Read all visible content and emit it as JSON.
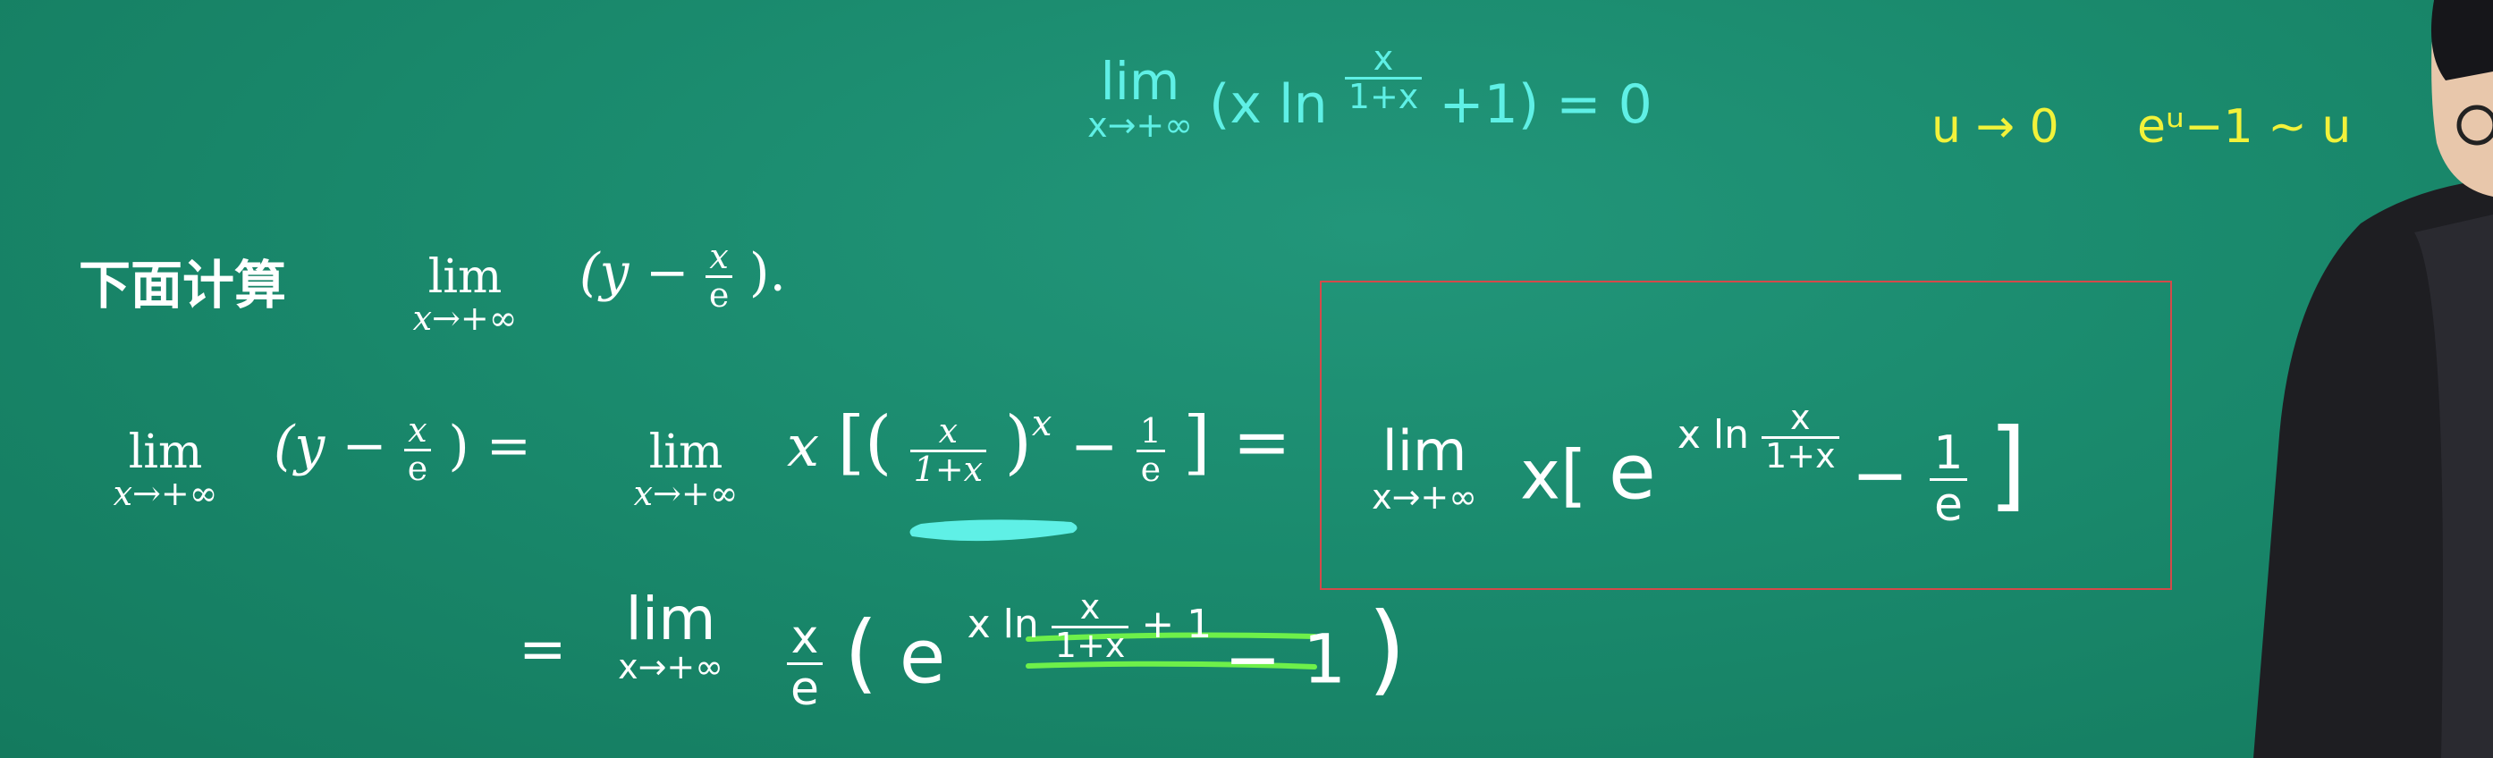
{
  "board": {
    "top_note": {
      "lim": "lim",
      "sub": "x→+∞",
      "expr_open": "(x ln",
      "frac_num": "x",
      "frac_den": "1+x",
      "expr_close": "+1) = 0"
    },
    "yellow_note": {
      "limit": "u → 0",
      "equiv": "eᵘ−1 ~ u"
    },
    "heading": {
      "label": "下面计算",
      "lim": "lim",
      "sub": "x→+∞",
      "expr_a": "(y −",
      "frac_num": "x",
      "frac_den": "e",
      "expr_b": ")."
    },
    "line1": {
      "lim1": "lim",
      "sub1": "x→+∞",
      "expr1": "(y −",
      "frac1_num": "x",
      "frac1_den": "e",
      "expr1_close": ") =",
      "lim2": "lim",
      "sub2": "x→+∞",
      "x_factor": "x",
      "bracket_open": "[(",
      "frac2_num": "x",
      "frac2_den": "1+x",
      "paren_close": ")",
      "power": "x",
      "minus": "−",
      "frac3_num": "1",
      "frac3_den": "e",
      "bracket_close": "] ="
    },
    "boxed": {
      "lim": "lim",
      "sub": "x→+∞",
      "x_factor": "x[",
      "e_base": "e",
      "exp_prefix": "x ln",
      "exp_frac_num": "x",
      "exp_frac_den": "1+x",
      "minus": "−",
      "frac_num": "1",
      "frac_den": "e",
      "close": "]"
    },
    "line2": {
      "equals": "=",
      "lim": "lim",
      "sub": "x→+∞",
      "frac_num": "x",
      "frac_den": "e",
      "open": "(",
      "e_base": "e",
      "exp_prefix": "x ln",
      "exp_frac_num": "x",
      "exp_frac_den": "1+x",
      "exp_suffix": "+ 1",
      "minus_one": "− 1",
      "close": ")"
    }
  },
  "colors": {
    "board": "#1a8a6d",
    "chalk_cyan": "#5ff0e6",
    "chalk_yellow": "#f2f23a",
    "chalk_green": "#6ef04a",
    "highlight_box": "#d44a4a"
  }
}
